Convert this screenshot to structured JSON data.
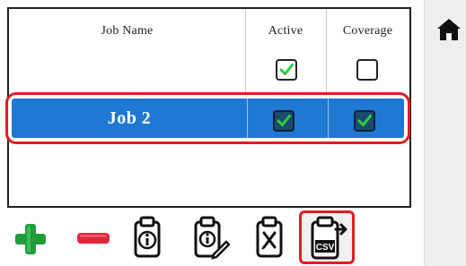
{
  "table": {
    "headers": {
      "job_name": "Job Name",
      "active": "Active",
      "coverage": "Coverage"
    },
    "rows": [
      {
        "job_name": "",
        "active": true,
        "coverage": false,
        "selected": false
      },
      {
        "job_name": "Job 2",
        "active": true,
        "coverage": true,
        "selected": true
      }
    ]
  },
  "colors": {
    "selection": "#1f78d1",
    "highlight_border": "#e11c24",
    "check_green": "#2ecc40",
    "add_green": "#1e9e3a",
    "remove_red": "#e0263a"
  },
  "toolbar": {
    "buttons": [
      {
        "name": "add-job-button",
        "icon": "plus-icon"
      },
      {
        "name": "remove-job-button",
        "icon": "minus-icon"
      },
      {
        "name": "job-info-button",
        "icon": "clipboard-info-icon"
      },
      {
        "name": "edit-job-info-button",
        "icon": "clipboard-edit-icon"
      },
      {
        "name": "clear-job-button",
        "icon": "clipboard-x-icon"
      },
      {
        "name": "export-csv-button",
        "icon": "clipboard-csv-icon",
        "label": "CSV",
        "highlighted": true
      }
    ]
  },
  "side": {
    "home_icon": "home-icon"
  }
}
